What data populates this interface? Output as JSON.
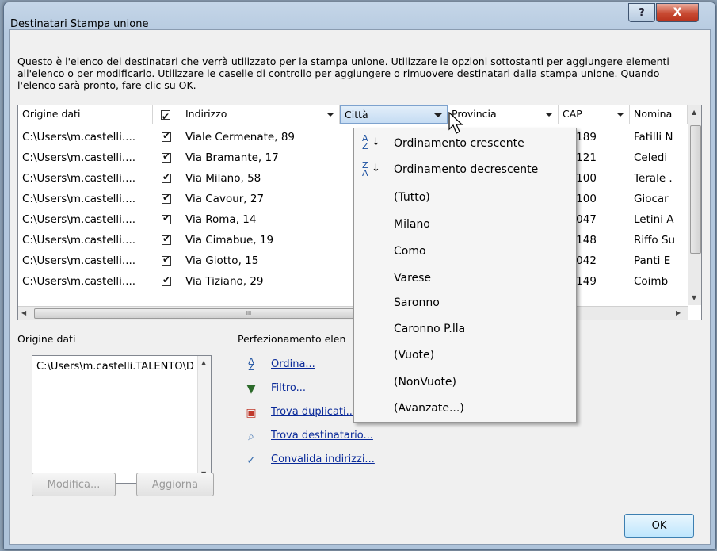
{
  "window": {
    "title": "Destinatari Stampa unione",
    "help_label": "?",
    "close_label": "X"
  },
  "description": "Questo è l'elenco dei destinatari che verrà utilizzato per la stampa unione. Utilizzare le opzioni sottostanti per aggiungere elementi all'elenco o per modificarlo. Utilizzare le caselle di controllo per aggiungere o rimuovere destinatari dalla stampa unione. Quando l'elenco sarà pronto, fare clic su OK.",
  "table": {
    "columns": [
      "Origine dati",
      "",
      "Indirizzo",
      "Città",
      "Provincia",
      "CAP",
      "Nomina"
    ],
    "rows": [
      {
        "source": "C:\\Users\\m.castelli....",
        "checked": true,
        "address": "Viale Cermenate, 89",
        "cap": "20189",
        "name": "Fatilli N"
      },
      {
        "source": "C:\\Users\\m.castelli....",
        "checked": true,
        "address": "Via Bramante, 17",
        "cap": "20121",
        "name": "Celedi"
      },
      {
        "source": "C:\\Users\\m.castelli....",
        "checked": true,
        "address": "Via Milano, 58",
        "cap": "22100",
        "name": "Terale ."
      },
      {
        "source": "C:\\Users\\m.castelli....",
        "checked": true,
        "address": "Via Cavour, 27",
        "cap": "21100",
        "name": "Giocar"
      },
      {
        "source": "C:\\Users\\m.castelli....",
        "checked": true,
        "address": "Via Roma, 14",
        "cap": "21047",
        "name": "Letini A"
      },
      {
        "source": "C:\\Users\\m.castelli....",
        "checked": true,
        "address": "Via Cimabue, 19",
        "cap": "20148",
        "name": "Riffo Su"
      },
      {
        "source": "C:\\Users\\m.castelli....",
        "checked": true,
        "address": "Via Giotto, 15",
        "cap": "21042",
        "name": "Panti E"
      },
      {
        "source": "C:\\Users\\m.castelli....",
        "checked": true,
        "address": "Via Tiziano, 29",
        "cap": "20149",
        "name": "Coimb"
      }
    ],
    "hscroll_grip": "III"
  },
  "source_panel": {
    "label": "Origine dati",
    "item": "C:\\Users\\m.castelli.TALENTO\\D",
    "edit_button": "Modifica...",
    "refresh_button": "Aggiorna"
  },
  "refine_panel": {
    "label": "Perfezionamento elen",
    "links": [
      "Ordina...",
      "Filtro...",
      "Trova duplicati...",
      "Trova destinatario...",
      "Convalida indirizzi..."
    ]
  },
  "city_menu": {
    "sort_icon_top": "A",
    "sort_icon_bottom": "Z",
    "items": [
      "Ordinamento crescente",
      "Ordinamento decrescente",
      "(Tutto)",
      "Milano",
      "Como",
      "Varese",
      "Saronno",
      "Caronno P.lla",
      "(Vuote)",
      "(NonVuote)",
      "(Avanzate...)"
    ]
  },
  "ok_button": "OK"
}
